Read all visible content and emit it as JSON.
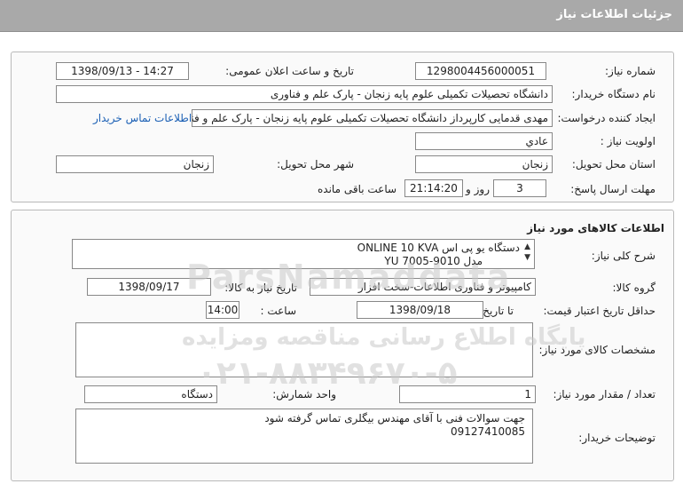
{
  "header": {
    "title": "جزئیات اطلاعات نیاز"
  },
  "need": {
    "number_label": "شماره نیاز:",
    "number_value": "1298004456000051",
    "announce_label": "تاریخ و ساعت اعلان عمومی:",
    "announce_value": "1398/09/13 - 14:27",
    "buyer_label": "نام دستگاه خریدار:",
    "buyer_value": "دانشگاه تحصیلات تکمیلی علوم پایه زنجان - پارک علم و فناوری",
    "creator_label": "ایجاد کننده درخواست:",
    "creator_value": "مهدی قدمایی کارپرداز دانشگاه تحصیلات تکمیلی علوم پایه زنجان - پارک علم و فناوری",
    "contact_link": "اطلاعات تماس خریدار",
    "priority_label": "اولویت نیاز :",
    "priority_value": "عادي",
    "province_label": "استان محل تحویل:",
    "province_value": "زنجان",
    "city_label": "شهر محل تحویل:",
    "city_value": "زنجان",
    "deadline_label": "مهلت ارسال پاسخ:",
    "days_value": "3",
    "days_and": "روز و",
    "time_value": "21:14:20",
    "remaining": "ساعت باقی مانده"
  },
  "goods": {
    "section_title": "اطلاعات کالاهای مورد نیاز",
    "desc_label": "شرح کلی نیاز:",
    "desc_line1": "دستگاه یو پی اس ONLINE 10 KVA",
    "desc_line2": "مدل   YU 7005-9010",
    "group_label": "گروه کالا:",
    "group_value": "کامپیوتر و فناوری اطلاعات-سخت افزار",
    "need_date_label": "تاریخ نیاز به کالا:",
    "need_date_value": "1398/09/17",
    "validity_label": "حداقل تاریخ اعتبار قیمت:",
    "until_date_label": "تا تاریخ :",
    "until_date_value": "1398/09/18",
    "hour_label": "ساعت :",
    "hour_value": "14:00",
    "spec_label": "مشخصات کالای مورد نیاز:",
    "qty_label": "تعداد / مقدار مورد نیاز:",
    "qty_value": "1",
    "unit_label": "واحد شمارش:",
    "unit_value": "دستگاه",
    "buyer_notes_label": "توضیحات خریدار:",
    "buyer_notes_line1": "جهت سوالات فنی با آقای مهندس بیگلری تماس گرفته شود",
    "buyer_notes_line2": "09127410085"
  },
  "watermark": {
    "line1": "پایگاه اطلاع رسانی مناقصه ومزایده",
    "line2": "۰۲۱-۸۸۳۴۹۶۷۰-۵",
    "line3": "ParsNamaddata"
  }
}
